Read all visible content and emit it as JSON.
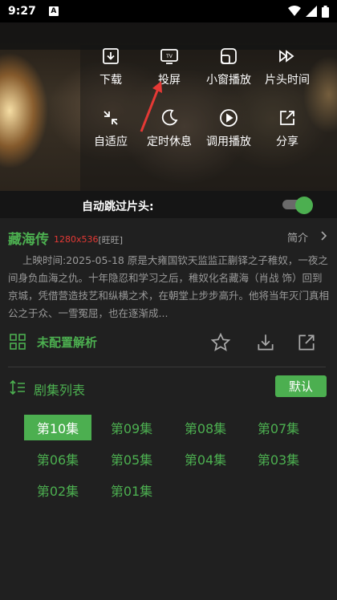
{
  "status_bar": {
    "time": "9:27",
    "notification_icon": "A"
  },
  "player_menu": {
    "items": [
      {
        "label": "下载",
        "icon": "download-icon"
      },
      {
        "label": "投屏",
        "icon": "cast-tv-icon"
      },
      {
        "label": "小窗播放",
        "icon": "pip-icon"
      },
      {
        "label": "片头时间",
        "icon": "skip-forward-icon"
      },
      {
        "label": "自适应",
        "icon": "fit-screen-icon"
      },
      {
        "label": "定时休息",
        "icon": "moon-timer-icon"
      },
      {
        "label": "调用播放",
        "icon": "play-circle-icon"
      },
      {
        "label": "分享",
        "icon": "share-icon"
      }
    ]
  },
  "auto_skip": {
    "label": "自动跳过片头:",
    "enabled": true
  },
  "info": {
    "title": "藏海传",
    "resolution": "1280x536",
    "source": "[旺旺]",
    "intro_label": "简介",
    "description": "上映时间:2025-05-18 原是大雍国钦天监监正蒯铎之子稚奴，一夜之间身负血海之仇。十年隐忍和学习之后，稚奴化名藏海（肖战 饰）回到京城，凭借营造技艺和纵横之术，在朝堂上步步高升。他将当年灭门真相公之于众、一雪冤屈，也在逐渐成..."
  },
  "actions": {
    "parse_label": "未配置解析"
  },
  "episode_list": {
    "header": "剧集列表",
    "sort_label": "默认",
    "episodes": [
      "第10集",
      "第09集",
      "第08集",
      "第07集",
      "第06集",
      "第05集",
      "第04集",
      "第03集",
      "第02集",
      "第01集"
    ],
    "selected": "第10集"
  },
  "colors": {
    "accent": "#4caf50",
    "resolution": "#e53935",
    "background": "#202020"
  }
}
